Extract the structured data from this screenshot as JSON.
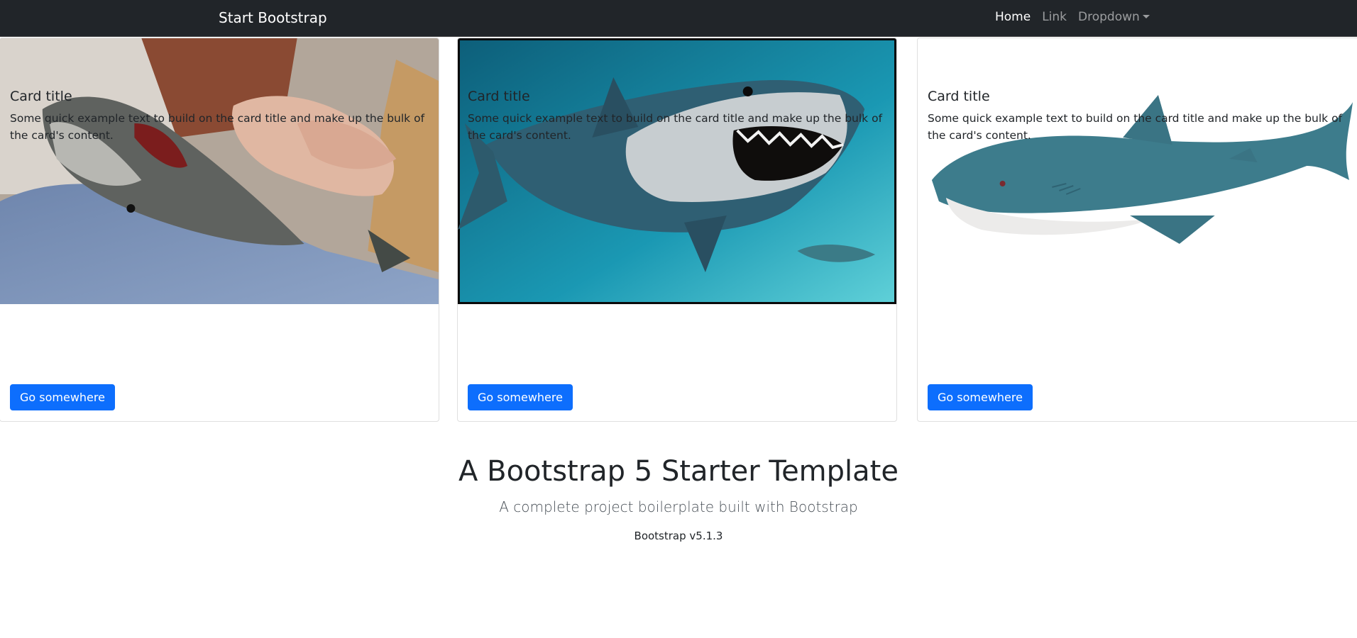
{
  "navbar": {
    "brand": "Start Bootstrap",
    "links": [
      {
        "label": "Home",
        "active": true
      },
      {
        "label": "Link",
        "active": false
      },
      {
        "label": "Dropdown",
        "active": false
      }
    ]
  },
  "cards": [
    {
      "image": "toy-shark-in-hands",
      "title": "Card title",
      "text": "Some quick example text to build on the card title and make up the bulk of the card's content.",
      "button": "Go somewhere"
    },
    {
      "image": "great-white-shark-underwater",
      "title": "Card title",
      "text": "Some quick example text to build on the card title and make up the bulk of the card's content.",
      "button": "Go somewhere"
    },
    {
      "image": "plush-shark-toy",
      "title": "Card title",
      "text": "Some quick example text to build on the card title and make up the bulk of the card's content.",
      "button": "Go somewhere"
    }
  ],
  "hero": {
    "title": "A Bootstrap 5 Starter Template",
    "lead": "A complete project boilerplate built with Bootstrap",
    "version": "Bootstrap v5.1.3"
  },
  "colors": {
    "navbar_bg": "#212529",
    "primary": "#0d6efd",
    "text": "#212529"
  }
}
